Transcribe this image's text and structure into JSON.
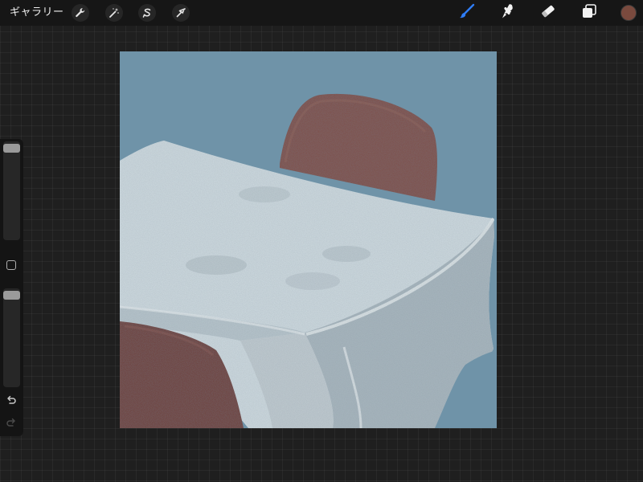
{
  "topbar": {
    "gallery_label": "ギャラリー",
    "left_tools": [
      "wrench-icon",
      "magic-wand-icon",
      "selection-icon",
      "transform-icon"
    ],
    "right_tools": [
      "brush-icon",
      "smudge-icon",
      "eraser-icon",
      "layers-icon"
    ],
    "active_tool": "brush",
    "active_color": "#7a4a3e",
    "accent_color": "#2f7df6"
  },
  "sidebar": {
    "brush_size_slider": "brush-size-slider",
    "modify_button": "color-picker-square-icon",
    "opacity_slider": "opacity-slider",
    "undo": "undo-icon",
    "redo": "redo-icon"
  },
  "canvas": {
    "background_color": "#6f93a8",
    "tablecloth_color": "#cfdbe1",
    "chair_color": "#7e4b42"
  }
}
